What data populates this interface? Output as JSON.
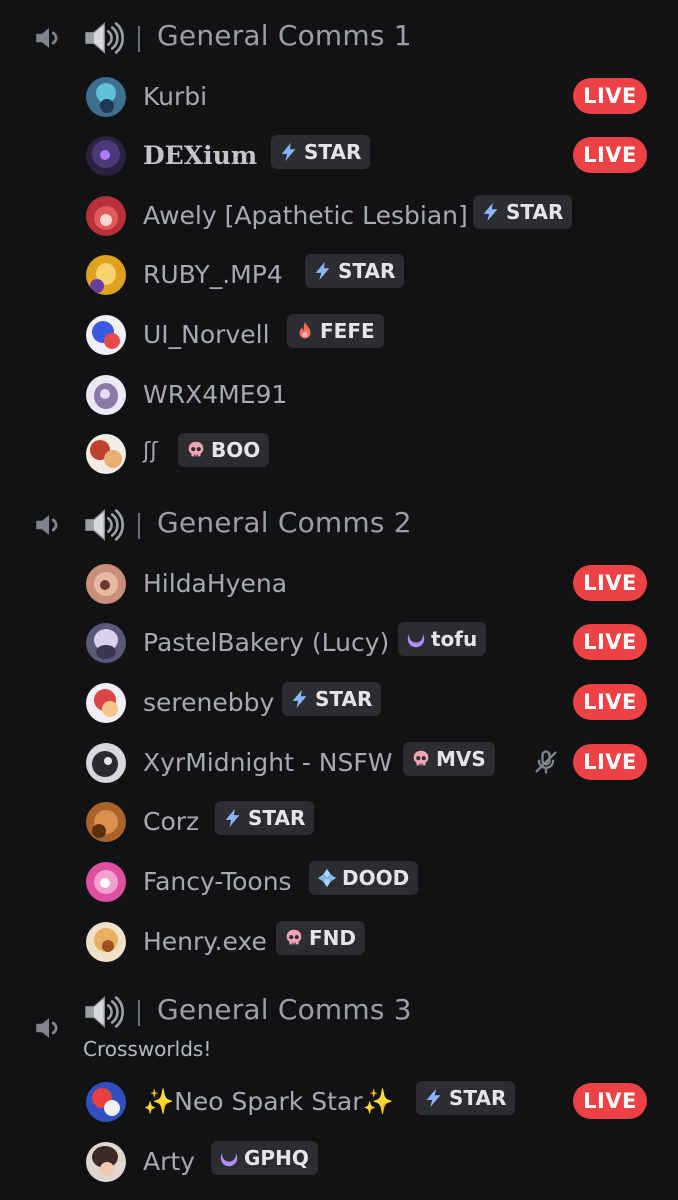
{
  "channels": [
    {
      "name": "General Comms 1",
      "users": [
        {
          "name": "Kurbi",
          "live": "LIVE"
        },
        {
          "name": "DEXium",
          "tag": "STAR",
          "tag_icon": "lightning-icon",
          "live": "LIVE"
        },
        {
          "name": "Awely [Apathetic Lesbian]",
          "tag": "STAR",
          "tag_icon": "lightning-icon"
        },
        {
          "name": "RUBY_.MP4",
          "tag": "STAR",
          "tag_icon": "lightning-icon"
        },
        {
          "name": "UI_Norvell",
          "tag": "FEFE",
          "tag_icon": "flame-icon"
        },
        {
          "name": "WRX4ME91"
        },
        {
          "name": "ʃʃ",
          "tag": "BOO",
          "tag_icon": "skull-icon"
        }
      ]
    },
    {
      "name": "General Comms 2",
      "users": [
        {
          "name": "HildaHyena",
          "live": "LIVE"
        },
        {
          "name": "PastelBakery (Lucy)",
          "tag": "tofu",
          "tag_icon": "moon-icon",
          "live": "LIVE"
        },
        {
          "name": "serenebby",
          "tag": "STAR",
          "tag_icon": "lightning-icon",
          "live": "LIVE"
        },
        {
          "name": "XyrMidnight - NSFW",
          "tag": "MVS",
          "tag_icon": "skull-icon",
          "muted": true,
          "live": "LIVE"
        },
        {
          "name": "Corz",
          "tag": "STAR",
          "tag_icon": "lightning-icon"
        },
        {
          "name": "Fancy-Toons",
          "tag": "DOOD",
          "tag_icon": "diamond-icon"
        },
        {
          "name": "Henry.exe",
          "tag": "FND",
          "tag_icon": "skull-icon"
        }
      ]
    },
    {
      "name": "General Comms 3",
      "topic": "Crossworlds!",
      "users": [
        {
          "name": "✨Neo Spark Star✨",
          "tag": "STAR",
          "tag_icon": "lightning-icon",
          "live": "LIVE"
        },
        {
          "name": "Arty",
          "tag": "GPHQ",
          "tag_icon": "moon-icon"
        }
      ]
    }
  ],
  "colors": {
    "background": "#111214",
    "live_red": "#ed4245",
    "tag_bg": "#2b2d31",
    "text_muted": "#9b9ea5"
  }
}
